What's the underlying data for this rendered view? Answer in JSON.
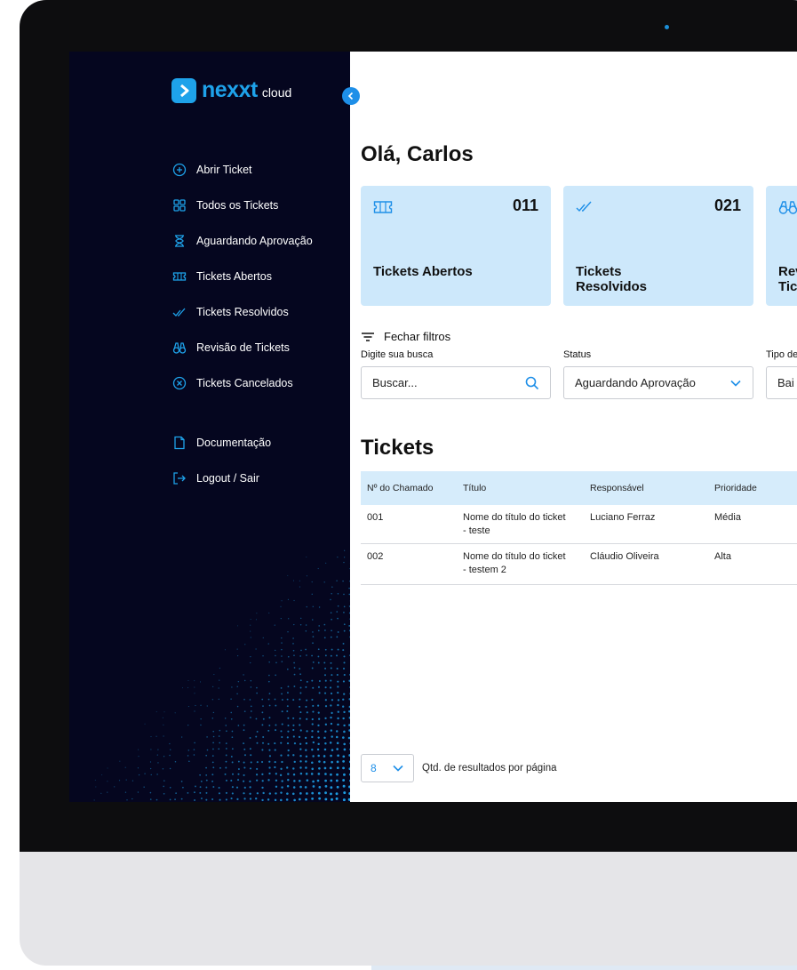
{
  "brand": {
    "name": "nexxt",
    "sub": "cloud"
  },
  "sidebar": {
    "items": [
      {
        "label": "Abrir Ticket",
        "icon": "plus-circle-icon"
      },
      {
        "label": "Todos os Tickets",
        "icon": "grid-icon"
      },
      {
        "label": "Aguardando Aprovação",
        "icon": "hourglass-icon"
      },
      {
        "label": "Tickets Abertos",
        "icon": "ticket-icon"
      },
      {
        "label": "Tickets Resolvidos",
        "icon": "double-check-icon"
      },
      {
        "label": "Revisão de Tickets",
        "icon": "binoculars-icon"
      },
      {
        "label": "Tickets Cancelados",
        "icon": "x-circle-icon"
      }
    ],
    "secondary": [
      {
        "label": "Documentação",
        "icon": "document-icon"
      },
      {
        "label": "Logout / Sair",
        "icon": "logout-icon"
      }
    ]
  },
  "main": {
    "greeting": "Olá, Carlos",
    "cards": [
      {
        "count": "011",
        "label": "Tickets Abertos",
        "icon": "ticket-icon"
      },
      {
        "count": "021",
        "label": "Tickets Resolvidos",
        "icon": "double-check-icon"
      },
      {
        "count": "",
        "label": "Revisão de Tickets",
        "icon": "binoculars-icon"
      }
    ],
    "filters": {
      "toggle_label": "Fechar filtros",
      "search_label": "Digite sua busca",
      "search_placeholder": "Buscar...",
      "status_label": "Status",
      "status_value": "Aguardando Aprovação",
      "type_label": "Tipo de",
      "type_value": "Bai"
    },
    "tickets_title": "Tickets",
    "table": {
      "columns": [
        "Nº do Chamado",
        "Título",
        "Responsável",
        "Prioridade"
      ],
      "rows": [
        {
          "id": "001",
          "title": "Nome do título do ticket - teste",
          "owner": "Luciano Ferraz",
          "priority": "Média"
        },
        {
          "id": "002",
          "title": "Nome do título do ticket - testem 2",
          "owner": "Cláudio Oliveira",
          "priority": "Alta"
        }
      ]
    },
    "pagination": {
      "per_page": "8",
      "label": "Qtd. de resultados por página"
    }
  },
  "colors": {
    "accent": "#1ea2ea",
    "sidebar_bg": "#05061f",
    "card_bg": "#cde8fb",
    "table_header_bg": "#d6ecfb"
  }
}
